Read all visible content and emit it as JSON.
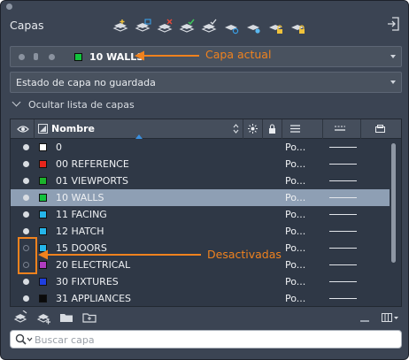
{
  "panel": {
    "title": "Capas",
    "toolbar_icons": [
      "new-layer-icon",
      "new-vp-frozen-layer-icon",
      "delete-layer-icon",
      "set-current-icon",
      "layer-states-icon",
      "layer-properties-icon",
      "freeze-layer-icon",
      "unlock-layer-icon",
      "lock-layer-icon"
    ]
  },
  "current_layer": {
    "name": "10 WALLS",
    "color": "#12c33c"
  },
  "layer_state": {
    "text": "Estado de capa no guardada"
  },
  "toggle_list": {
    "label": "Ocultar lista de capas"
  },
  "grid": {
    "columns": [
      "",
      "Nombre",
      "",
      "",
      "",
      "",
      ""
    ],
    "column_icons": [
      "eye-icon",
      "color-column-icon",
      "sun-icon",
      "lock-icon",
      "lineweight-icon",
      "linetype-icon",
      "plot-icon"
    ],
    "rows": [
      {
        "name": "0",
        "color": "#ffffff",
        "plot": "Po...",
        "on": true,
        "selected": false
      },
      {
        "name": "00 REFERENCE",
        "color": "#e8251b",
        "plot": "Po...",
        "on": true,
        "selected": false
      },
      {
        "name": "01 VIEWPORTS",
        "color": "#1cb42c",
        "plot": "Po...",
        "on": true,
        "selected": false
      },
      {
        "name": "10 WALLS",
        "color": "#12c33c",
        "plot": "Po...",
        "on": true,
        "selected": true
      },
      {
        "name": "11 FACING",
        "color": "#25b5ea",
        "plot": "Po...",
        "on": true,
        "selected": false
      },
      {
        "name": "12 HATCH",
        "color": "#25b5ea",
        "plot": "Po...",
        "on": true,
        "selected": false
      },
      {
        "name": "15 DOORS",
        "color": "#25b5ea",
        "plot": "Po...",
        "on": false,
        "selected": false
      },
      {
        "name": "20 ELECTRICAL",
        "color": "#b03cc0",
        "plot": "Po...",
        "on": false,
        "selected": false
      },
      {
        "name": "30 FIXTURES",
        "color": "#1f3fe0",
        "plot": "Po...",
        "on": true,
        "selected": false
      },
      {
        "name": "31 APPLIANCES",
        "color": "#0a0a0a",
        "plot": "Po...",
        "on": true,
        "selected": false
      }
    ]
  },
  "search": {
    "placeholder": "Buscar capa"
  },
  "annotations": {
    "current": "Capa actual",
    "off": "Desactivadas",
    "color": "#f0821e"
  },
  "colors": {
    "panel_bg": "#3b4453",
    "selection": "#8e9fb4",
    "accent": "#3a8fe0"
  }
}
